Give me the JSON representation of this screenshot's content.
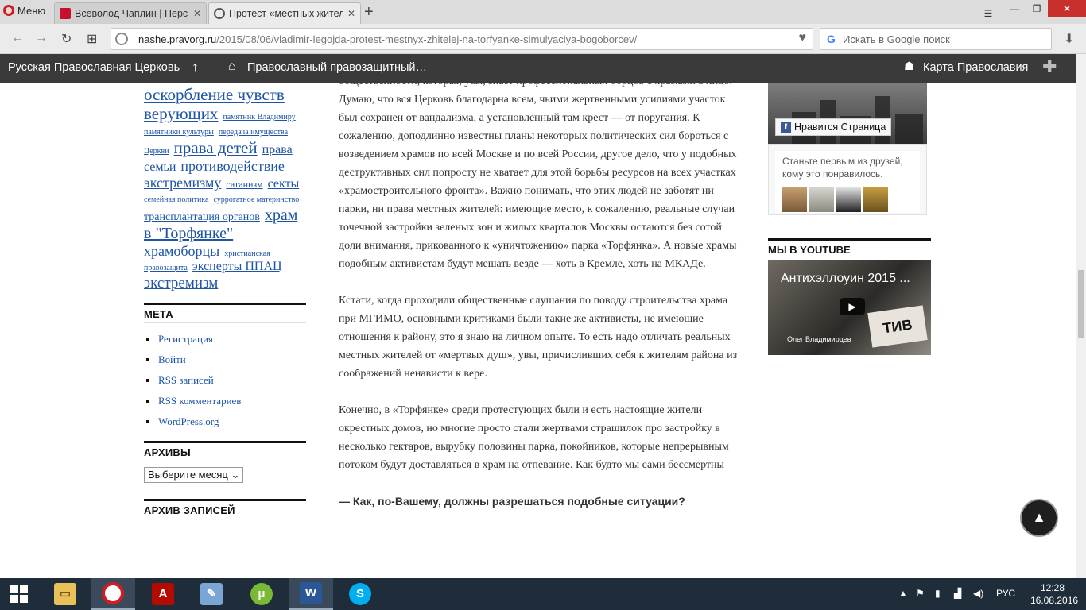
{
  "browser": {
    "menu_label": "Меню",
    "tabs": [
      {
        "title": "Всеволод Чаплин | Персо",
        "active": false
      },
      {
        "title": "Протест «местных жителе",
        "active": true
      }
    ],
    "url_domain": "nashe.pravorg.ru",
    "url_path": "/2015/08/06/vladimir-legojda-protest-mestnyx-zhitelej-na-torfyanke-simulyaciya-bogoborcev/",
    "search_placeholder": "Искать в Google поиск"
  },
  "sitebar": {
    "item1": "Русская Православная Церковь",
    "item2": "Православный правозащитный…",
    "item3": "Карта Православия"
  },
  "sidebar_left": {
    "tags": [
      "оскорбление чувств верующих",
      "памятник Владимиру",
      "памятники культуры",
      "передача имущества Церкви",
      "права детей",
      "права семьи",
      "противодействие экстремизму",
      "сатанизм",
      "секты",
      "семейная политика",
      "суррогатное материнство",
      "трансплантация органов",
      "храм в \"Торфянке\"",
      "храмоборцы",
      "христианская правозащита",
      "эксперты ППАЦ",
      "экстремизм"
    ],
    "meta_title": "МЕТА",
    "meta_links": [
      "Регистрация",
      "Войти",
      "RSS записей",
      "RSS комментариев",
      "WordPress.org"
    ],
    "archives_title": "АРХИВЫ",
    "archives_select": "Выберите месяц",
    "archive_records_title": "АРХИВ ЗАПИСЕЙ"
  },
  "article": {
    "p1": "общественности, которая, увы, знает профессиональных борцов с храмами в лицо. Думаю, что вся Церковь благодарна всем, чьими жертвенными усилиями участок был сохранен от вандализма, а установленный там крест — от поругания. К сожалению, доподлинно известны планы некоторых политических сил бороться с возведением храмов по всей Москве и по всей России, другое дело, что у подобных деструктивных сил попросту не хватает для этой борьбы ресурсов на всех участках «храмостроительного фронта». Важно понимать, что этих людей не заботят ни парки, ни права местных жителей: имеющие место, к сожалению, реальные случаи точечной застройки зеленых зон и жилых кварталов Москвы остаются без сотой доли внимания, прикованного к «уничтожению» парка «Торфянка». А новые храмы подобным активистам будут мешать везде — хоть в Кремле, хоть на МКАДе.",
    "p2": "Кстати, когда проходили общественные слушания по поводу строительства храма при МГИМО, основными критиками были такие же активисты, не имеющие отношения к району, это я знаю на личном опыте. То есть надо отличать реальных местных жителей от «мертвых душ», увы, причисливших себя к жителям района из соображений ненависти к вере.",
    "p3": "Конечно, в «Торфянке» среди протестующих были и есть настоящие жители окрестных домов, но многие просто стали жертвами страшилок про застройку в несколько гектаров, вырубку половины парка, покойников, которые непрерывным потоком будут доставляться в храм на отпевание. Как будто мы сами бессмертны",
    "q": "— Как, по-Вашему, должны разрешаться подобные ситуации?"
  },
  "sidebar_right": {
    "fb_like_label": "Нравится Страница",
    "fb_friends_text": "Станьте первым из друзей, кому это понравилось.",
    "youtube_title": "МЫ В YOUTUBE",
    "video_title": "Антихэллоуин 2015 ...",
    "video_sign": "ТИВ",
    "video_caption": "Олег Владимирцев"
  },
  "taskbar": {
    "lang": "РУС",
    "time": "12:28",
    "date": "16.08.2016"
  },
  "colors": {
    "link": "#1e54a6",
    "sitebar_bg": "#3a3a3a",
    "taskbar_bg": "#1f2d3a"
  }
}
